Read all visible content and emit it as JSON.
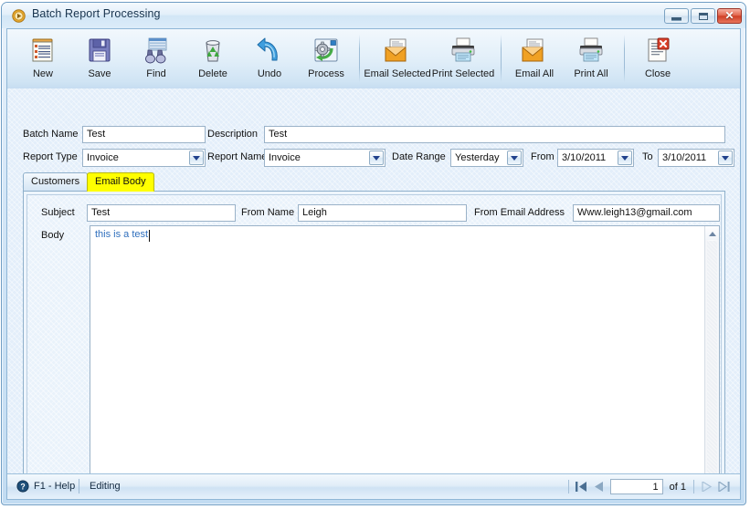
{
  "window": {
    "title": "Batch Report Processing",
    "icon": "play-circle-icon",
    "minimize_label": "Minimize",
    "maximize_label": "Maximize",
    "close_label": "✕"
  },
  "toolbar": {
    "items": [
      {
        "label": "New",
        "icon": "new-document-icon"
      },
      {
        "label": "Save",
        "icon": "floppy-disk-icon"
      },
      {
        "label": "Find",
        "icon": "binoculars-icon"
      },
      {
        "label": "Delete",
        "icon": "recycle-bin-icon"
      },
      {
        "label": "Undo",
        "icon": "undo-arrow-icon"
      },
      {
        "label": "Process",
        "icon": "gear-process-icon"
      },
      {
        "label": "Email Selected",
        "icon": "email-envelope-icon"
      },
      {
        "label": "Print Selected",
        "icon": "printer-icon"
      },
      {
        "label": "Email All",
        "icon": "email-envelope-icon"
      },
      {
        "label": "Print All",
        "icon": "printer-icon"
      },
      {
        "label": "Close",
        "icon": "close-document-icon"
      }
    ]
  },
  "form": {
    "batch_name_label": "Batch Name",
    "batch_name_value": "Test",
    "description_label": "Description",
    "description_value": "Test",
    "report_type_label": "Report Type",
    "report_type_value": "Invoice",
    "report_name_label": "Report Name",
    "report_name_value": "Invoice",
    "date_range_label": "Date Range",
    "date_range_value": "Yesterday",
    "from_label": "From",
    "from_value": "3/10/2011",
    "to_label": "To",
    "to_value": "3/10/2011"
  },
  "tabs": [
    {
      "label": "Customers",
      "active": false
    },
    {
      "label": "Email Body",
      "active": true
    }
  ],
  "email_body": {
    "subject_label": "Subject",
    "subject_value": "Test",
    "from_name_label": "From Name",
    "from_name_value": "Leigh",
    "from_email_label": "From Email Address",
    "from_email_value": "Www.leigh13@gmail.com",
    "body_label": "Body",
    "body_value": "this is a test"
  },
  "statusbar": {
    "help_icon": "question-mark-icon",
    "help_label": "F1 - Help",
    "mode_label": "Editing",
    "nav": {
      "first_label": "First",
      "prev_label": "Previous",
      "page_value": "1",
      "of_label": "of 1",
      "next_label": "Next",
      "last_label": "Last"
    }
  },
  "colors": {
    "accent": "#2f6fbd",
    "tab_highlight": "#ffff00",
    "close_button": "#cf4026",
    "panel_bg": "#e3eefa"
  }
}
